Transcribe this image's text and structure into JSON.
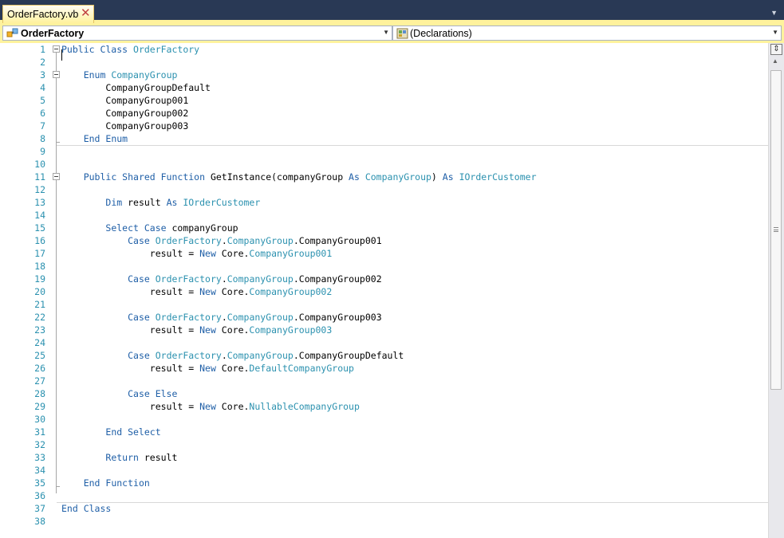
{
  "tab": {
    "title": "OrderFactory.vb",
    "close_glyph": "✕",
    "menu_glyph": "▼"
  },
  "navbar": {
    "class_combo": "OrderFactory",
    "member_combo": "(Declarations)",
    "arrow_glyph": "▼"
  },
  "scrollbar": {
    "split_glyph": "⇕",
    "up_glyph": "▲"
  },
  "colors": {
    "keyword": "#1F5FA7",
    "type": "#2B91AF",
    "line_number": "#2B91AF",
    "tab_active": "#FFF29D",
    "chrome": "#293955"
  },
  "code_lines": [
    {
      "n": "1",
      "indent": "",
      "parts": [
        {
          "t": "Public Class ",
          "c": "kw"
        },
        {
          "t": "OrderFactory",
          "c": "ty"
        }
      ]
    },
    {
      "n": "2",
      "indent": "",
      "parts": []
    },
    {
      "n": "3",
      "indent": "    ",
      "parts": [
        {
          "t": "Enum ",
          "c": "kw"
        },
        {
          "t": "CompanyGroup",
          "c": "ty"
        }
      ]
    },
    {
      "n": "4",
      "indent": "        ",
      "parts": [
        {
          "t": "CompanyGroupDefault",
          "c": ""
        }
      ]
    },
    {
      "n": "5",
      "indent": "        ",
      "parts": [
        {
          "t": "CompanyGroup001",
          "c": ""
        }
      ]
    },
    {
      "n": "6",
      "indent": "        ",
      "parts": [
        {
          "t": "CompanyGroup002",
          "c": ""
        }
      ]
    },
    {
      "n": "7",
      "indent": "        ",
      "parts": [
        {
          "t": "CompanyGroup003",
          "c": ""
        }
      ]
    },
    {
      "n": "8",
      "indent": "    ",
      "parts": [
        {
          "t": "End Enum",
          "c": "kw"
        }
      ]
    },
    {
      "n": "9",
      "indent": "",
      "parts": []
    },
    {
      "n": "10",
      "indent": "",
      "parts": []
    },
    {
      "n": "11",
      "indent": "    ",
      "parts": [
        {
          "t": "Public Shared Function ",
          "c": "kw"
        },
        {
          "t": "GetInstance(companyGroup ",
          "c": ""
        },
        {
          "t": "As ",
          "c": "kw"
        },
        {
          "t": "CompanyGroup",
          "c": "ty"
        },
        {
          "t": ") ",
          "c": ""
        },
        {
          "t": "As ",
          "c": "kw"
        },
        {
          "t": "IOrderCustomer",
          "c": "ty"
        }
      ]
    },
    {
      "n": "12",
      "indent": "",
      "parts": []
    },
    {
      "n": "13",
      "indent": "        ",
      "parts": [
        {
          "t": "Dim ",
          "c": "kw"
        },
        {
          "t": "result ",
          "c": ""
        },
        {
          "t": "As ",
          "c": "kw"
        },
        {
          "t": "IOrderCustomer",
          "c": "ty"
        }
      ]
    },
    {
      "n": "14",
      "indent": "",
      "parts": []
    },
    {
      "n": "15",
      "indent": "        ",
      "parts": [
        {
          "t": "Select Case ",
          "c": "kw"
        },
        {
          "t": "companyGroup",
          "c": ""
        }
      ]
    },
    {
      "n": "16",
      "indent": "            ",
      "parts": [
        {
          "t": "Case ",
          "c": "kw"
        },
        {
          "t": "OrderFactory",
          "c": "ty"
        },
        {
          "t": ".",
          "c": ""
        },
        {
          "t": "CompanyGroup",
          "c": "ty"
        },
        {
          "t": ".CompanyGroup001",
          "c": ""
        }
      ]
    },
    {
      "n": "17",
      "indent": "                ",
      "parts": [
        {
          "t": "result = ",
          "c": ""
        },
        {
          "t": "New ",
          "c": "kw"
        },
        {
          "t": "Core.",
          "c": ""
        },
        {
          "t": "CompanyGroup001",
          "c": "ty"
        }
      ]
    },
    {
      "n": "18",
      "indent": "",
      "parts": []
    },
    {
      "n": "19",
      "indent": "            ",
      "parts": [
        {
          "t": "Case ",
          "c": "kw"
        },
        {
          "t": "OrderFactory",
          "c": "ty"
        },
        {
          "t": ".",
          "c": ""
        },
        {
          "t": "CompanyGroup",
          "c": "ty"
        },
        {
          "t": ".CompanyGroup002",
          "c": ""
        }
      ]
    },
    {
      "n": "20",
      "indent": "                ",
      "parts": [
        {
          "t": "result = ",
          "c": ""
        },
        {
          "t": "New ",
          "c": "kw"
        },
        {
          "t": "Core.",
          "c": ""
        },
        {
          "t": "CompanyGroup002",
          "c": "ty"
        }
      ]
    },
    {
      "n": "21",
      "indent": "",
      "parts": []
    },
    {
      "n": "22",
      "indent": "            ",
      "parts": [
        {
          "t": "Case ",
          "c": "kw"
        },
        {
          "t": "OrderFactory",
          "c": "ty"
        },
        {
          "t": ".",
          "c": ""
        },
        {
          "t": "CompanyGroup",
          "c": "ty"
        },
        {
          "t": ".CompanyGroup003",
          "c": ""
        }
      ]
    },
    {
      "n": "23",
      "indent": "                ",
      "parts": [
        {
          "t": "result = ",
          "c": ""
        },
        {
          "t": "New ",
          "c": "kw"
        },
        {
          "t": "Core.",
          "c": ""
        },
        {
          "t": "CompanyGroup003",
          "c": "ty"
        }
      ]
    },
    {
      "n": "24",
      "indent": "",
      "parts": []
    },
    {
      "n": "25",
      "indent": "            ",
      "parts": [
        {
          "t": "Case ",
          "c": "kw"
        },
        {
          "t": "OrderFactory",
          "c": "ty"
        },
        {
          "t": ".",
          "c": ""
        },
        {
          "t": "CompanyGroup",
          "c": "ty"
        },
        {
          "t": ".CompanyGroupDefault",
          "c": ""
        }
      ]
    },
    {
      "n": "26",
      "indent": "                ",
      "parts": [
        {
          "t": "result = ",
          "c": ""
        },
        {
          "t": "New ",
          "c": "kw"
        },
        {
          "t": "Core.",
          "c": ""
        },
        {
          "t": "DefaultCompanyGroup",
          "c": "ty"
        }
      ]
    },
    {
      "n": "27",
      "indent": "",
      "parts": []
    },
    {
      "n": "28",
      "indent": "            ",
      "parts": [
        {
          "t": "Case Else",
          "c": "kw"
        }
      ]
    },
    {
      "n": "29",
      "indent": "                ",
      "parts": [
        {
          "t": "result = ",
          "c": ""
        },
        {
          "t": "New ",
          "c": "kw"
        },
        {
          "t": "Core.",
          "c": ""
        },
        {
          "t": "NullableCompanyGroup",
          "c": "ty"
        }
      ]
    },
    {
      "n": "30",
      "indent": "",
      "parts": []
    },
    {
      "n": "31",
      "indent": "        ",
      "parts": [
        {
          "t": "End Select",
          "c": "kw"
        }
      ]
    },
    {
      "n": "32",
      "indent": "",
      "parts": []
    },
    {
      "n": "33",
      "indent": "        ",
      "parts": [
        {
          "t": "Return ",
          "c": "kw"
        },
        {
          "t": "result",
          "c": ""
        }
      ]
    },
    {
      "n": "34",
      "indent": "",
      "parts": []
    },
    {
      "n": "35",
      "indent": "    ",
      "parts": [
        {
          "t": "End Function",
          "c": "kw"
        }
      ]
    },
    {
      "n": "36",
      "indent": "",
      "parts": []
    },
    {
      "n": "37",
      "indent": "",
      "parts": [
        {
          "t": "End Class",
          "c": "kw"
        }
      ]
    },
    {
      "n": "38",
      "indent": "",
      "parts": []
    }
  ]
}
